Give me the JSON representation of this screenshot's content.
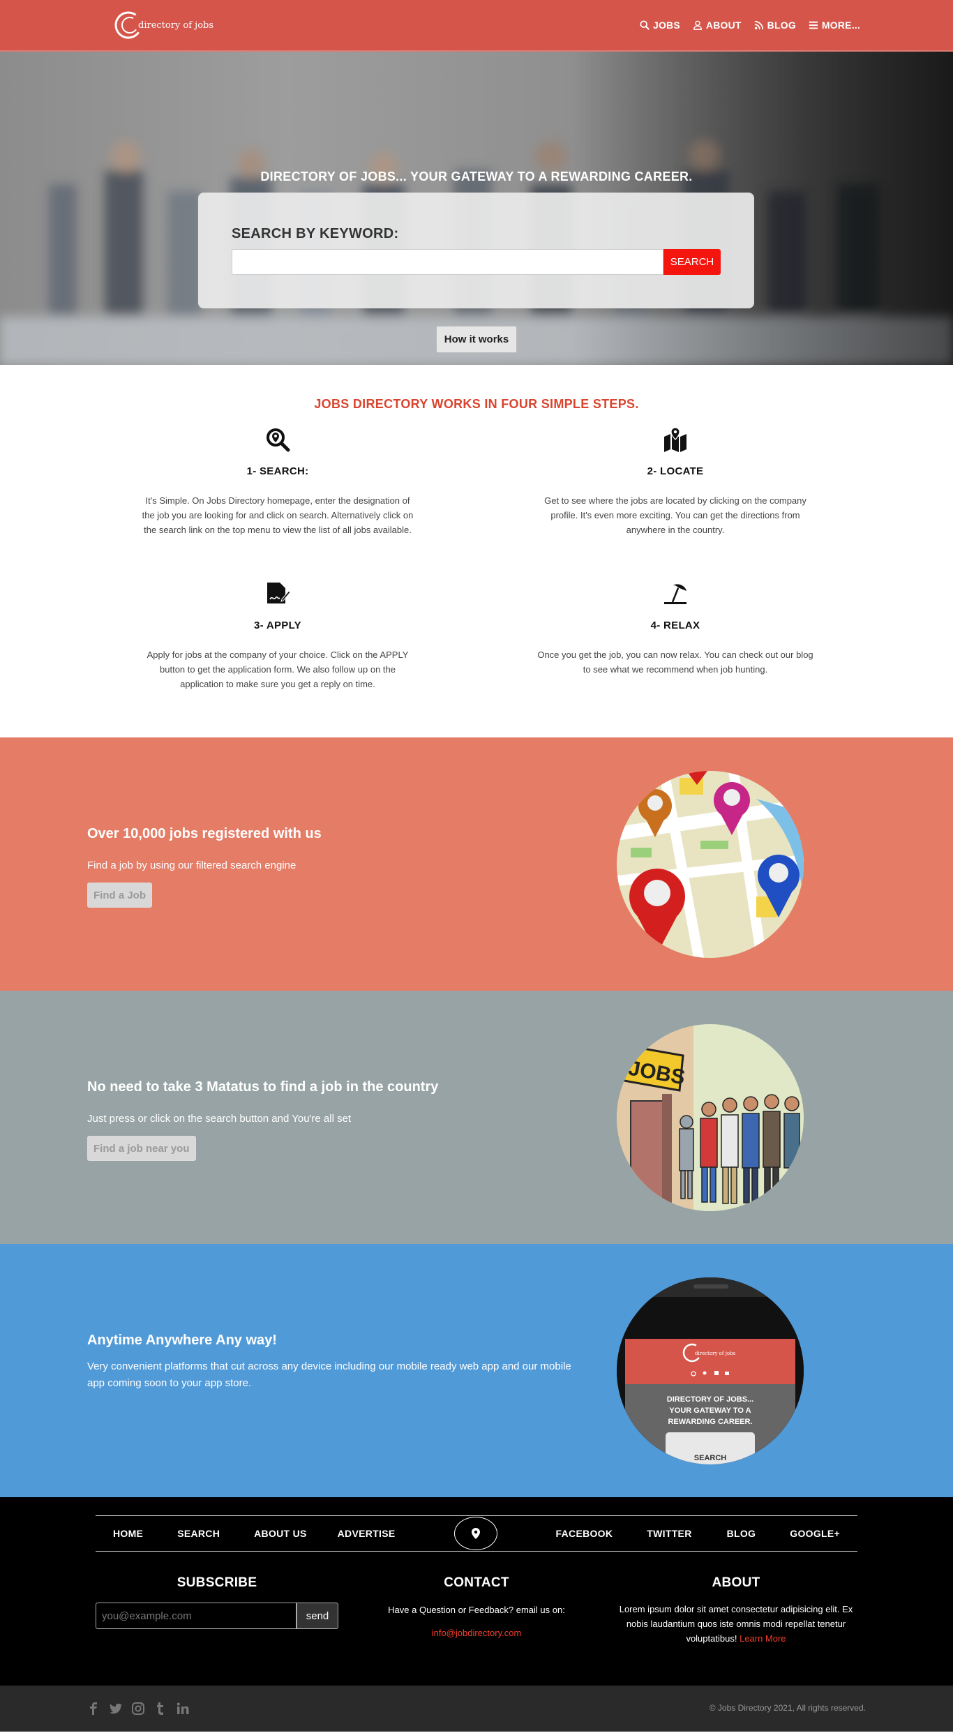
{
  "nav": {
    "brand": "directory of jobs",
    "links": [
      {
        "label": "JOBS",
        "icon": "search-icon"
      },
      {
        "label": "ABOUT",
        "icon": "user-icon"
      },
      {
        "label": "BLOG",
        "icon": "rss-icon"
      },
      {
        "label": "MORE...",
        "icon": "bars-icon"
      }
    ]
  },
  "hero": {
    "title": "DIRECTORY OF JOBS... YOUR GATEWAY TO A REWARDING CAREER.",
    "search_label": "SEARCH BY KEYWORD:",
    "search_value": "",
    "search_button": "SEARCH",
    "how_button": "How it works"
  },
  "steps": {
    "title": "JOBS DIRECTORY WORKS IN FOUR SIMPLE STEPS.",
    "items": [
      {
        "title": "1- SEARCH:",
        "text": "It's Simple. On Jobs Directory homepage, enter the designation of the job you are looking for and click on search. Alternatively click on the search link on the top menu to view the list of all jobs available.",
        "icon": "search-location-icon"
      },
      {
        "title": "2- LOCATE",
        "text": "Get to see where the jobs are located by clicking on the company profile. It's even more exciting. You can get the directions from anywhere in the country.",
        "icon": "map-marked-icon"
      },
      {
        "title": "3- APPLY",
        "text": "Apply for jobs at the company of your choice. Click on the APPLY button to get the application form. We also follow up on the application to make sure you get a reply on time.",
        "icon": "signature-icon"
      },
      {
        "title": "4- RELAX",
        "text": "Once you get the job, you can now relax. You can check out our blog to see what we recommend when job hunting.",
        "icon": "umbrella-beach-icon"
      }
    ]
  },
  "features": [
    {
      "title": "Over 10,000 jobs registered with us",
      "text": "Find a job by using our filtered search engine",
      "button": "Find a Job",
      "color": "#e47c66"
    },
    {
      "title": "No need to take 3 Matatus to find a job in the country",
      "text": "Just press or click on the search button and You're all set",
      "button": "Find a job near you",
      "color": "#97a3a4"
    },
    {
      "title": "Anytime Anywhere Any way!",
      "text": "Very convenient platforms that cut across any device including our mobile ready web app and our mobile app coming soon to your app store.",
      "button": "",
      "color": "#519ad8"
    }
  ],
  "phone_mock": {
    "brand": "directory of jobs",
    "line1": "DIRECTORY OF JOBS...",
    "line2": "YOUR GATEWAY TO A",
    "line3": "REWARDING CAREER.",
    "search": "SEARCH"
  },
  "jobs_sign": "JOBS",
  "footer": {
    "nav_left": [
      "HOME",
      "SEARCH",
      "ABOUT US",
      "ADVERTISE"
    ],
    "nav_right": [
      "FACEBOOK",
      "TWITTER",
      "BLOG",
      "GOOGLE+"
    ],
    "subscribe_title": "SUBSCRIBE",
    "subscribe_placeholder": "you@example.com",
    "subscribe_button": "send",
    "contact_title": "CONTACT",
    "contact_text": "Have a Question or Feedback? email us on:",
    "contact_email": "info@jobdirectory.com",
    "about_title": "ABOUT",
    "about_text": "Lorem ipsum dolor sit amet consectetur adipisicing elit. Ex nobis laudantium quos iste omnis modi repellat tenetur voluptatibus!",
    "about_link": "Learn More",
    "copyright": "© Jobs Directory 2021, All rights reserved.",
    "social": [
      "facebook-icon",
      "twitter-icon",
      "instagram-icon",
      "tumblr-icon",
      "linkedin-icon"
    ]
  }
}
